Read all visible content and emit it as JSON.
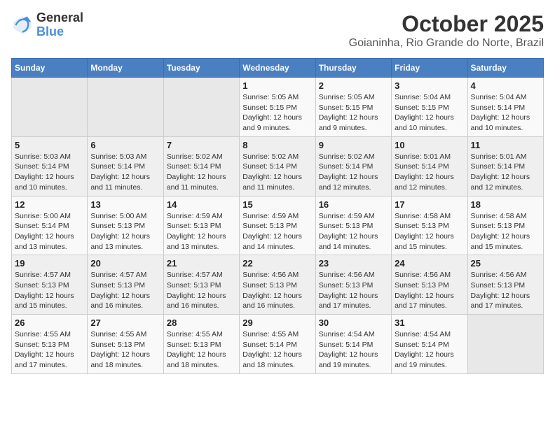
{
  "header": {
    "logo_general": "General",
    "logo_blue": "Blue",
    "month": "October 2025",
    "location": "Goianinha, Rio Grande do Norte, Brazil"
  },
  "calendar": {
    "days_of_week": [
      "Sunday",
      "Monday",
      "Tuesday",
      "Wednesday",
      "Thursday",
      "Friday",
      "Saturday"
    ],
    "weeks": [
      [
        {
          "day": "",
          "info": ""
        },
        {
          "day": "",
          "info": ""
        },
        {
          "day": "",
          "info": ""
        },
        {
          "day": "1",
          "info": "Sunrise: 5:05 AM\nSunset: 5:15 PM\nDaylight: 12 hours and 9 minutes."
        },
        {
          "day": "2",
          "info": "Sunrise: 5:05 AM\nSunset: 5:15 PM\nDaylight: 12 hours and 9 minutes."
        },
        {
          "day": "3",
          "info": "Sunrise: 5:04 AM\nSunset: 5:15 PM\nDaylight: 12 hours and 10 minutes."
        },
        {
          "day": "4",
          "info": "Sunrise: 5:04 AM\nSunset: 5:14 PM\nDaylight: 12 hours and 10 minutes."
        }
      ],
      [
        {
          "day": "5",
          "info": "Sunrise: 5:03 AM\nSunset: 5:14 PM\nDaylight: 12 hours and 10 minutes."
        },
        {
          "day": "6",
          "info": "Sunrise: 5:03 AM\nSunset: 5:14 PM\nDaylight: 12 hours and 11 minutes."
        },
        {
          "day": "7",
          "info": "Sunrise: 5:02 AM\nSunset: 5:14 PM\nDaylight: 12 hours and 11 minutes."
        },
        {
          "day": "8",
          "info": "Sunrise: 5:02 AM\nSunset: 5:14 PM\nDaylight: 12 hours and 11 minutes."
        },
        {
          "day": "9",
          "info": "Sunrise: 5:02 AM\nSunset: 5:14 PM\nDaylight: 12 hours and 12 minutes."
        },
        {
          "day": "10",
          "info": "Sunrise: 5:01 AM\nSunset: 5:14 PM\nDaylight: 12 hours and 12 minutes."
        },
        {
          "day": "11",
          "info": "Sunrise: 5:01 AM\nSunset: 5:14 PM\nDaylight: 12 hours and 12 minutes."
        }
      ],
      [
        {
          "day": "12",
          "info": "Sunrise: 5:00 AM\nSunset: 5:14 PM\nDaylight: 12 hours and 13 minutes."
        },
        {
          "day": "13",
          "info": "Sunrise: 5:00 AM\nSunset: 5:13 PM\nDaylight: 12 hours and 13 minutes."
        },
        {
          "day": "14",
          "info": "Sunrise: 4:59 AM\nSunset: 5:13 PM\nDaylight: 12 hours and 13 minutes."
        },
        {
          "day": "15",
          "info": "Sunrise: 4:59 AM\nSunset: 5:13 PM\nDaylight: 12 hours and 14 minutes."
        },
        {
          "day": "16",
          "info": "Sunrise: 4:59 AM\nSunset: 5:13 PM\nDaylight: 12 hours and 14 minutes."
        },
        {
          "day": "17",
          "info": "Sunrise: 4:58 AM\nSunset: 5:13 PM\nDaylight: 12 hours and 15 minutes."
        },
        {
          "day": "18",
          "info": "Sunrise: 4:58 AM\nSunset: 5:13 PM\nDaylight: 12 hours and 15 minutes."
        }
      ],
      [
        {
          "day": "19",
          "info": "Sunrise: 4:57 AM\nSunset: 5:13 PM\nDaylight: 12 hours and 15 minutes."
        },
        {
          "day": "20",
          "info": "Sunrise: 4:57 AM\nSunset: 5:13 PM\nDaylight: 12 hours and 16 minutes."
        },
        {
          "day": "21",
          "info": "Sunrise: 4:57 AM\nSunset: 5:13 PM\nDaylight: 12 hours and 16 minutes."
        },
        {
          "day": "22",
          "info": "Sunrise: 4:56 AM\nSunset: 5:13 PM\nDaylight: 12 hours and 16 minutes."
        },
        {
          "day": "23",
          "info": "Sunrise: 4:56 AM\nSunset: 5:13 PM\nDaylight: 12 hours and 17 minutes."
        },
        {
          "day": "24",
          "info": "Sunrise: 4:56 AM\nSunset: 5:13 PM\nDaylight: 12 hours and 17 minutes."
        },
        {
          "day": "25",
          "info": "Sunrise: 4:56 AM\nSunset: 5:13 PM\nDaylight: 12 hours and 17 minutes."
        }
      ],
      [
        {
          "day": "26",
          "info": "Sunrise: 4:55 AM\nSunset: 5:13 PM\nDaylight: 12 hours and 17 minutes."
        },
        {
          "day": "27",
          "info": "Sunrise: 4:55 AM\nSunset: 5:13 PM\nDaylight: 12 hours and 18 minutes."
        },
        {
          "day": "28",
          "info": "Sunrise: 4:55 AM\nSunset: 5:13 PM\nDaylight: 12 hours and 18 minutes."
        },
        {
          "day": "29",
          "info": "Sunrise: 4:55 AM\nSunset: 5:14 PM\nDaylight: 12 hours and 18 minutes."
        },
        {
          "day": "30",
          "info": "Sunrise: 4:54 AM\nSunset: 5:14 PM\nDaylight: 12 hours and 19 minutes."
        },
        {
          "day": "31",
          "info": "Sunrise: 4:54 AM\nSunset: 5:14 PM\nDaylight: 12 hours and 19 minutes."
        },
        {
          "day": "",
          "info": ""
        }
      ]
    ]
  }
}
